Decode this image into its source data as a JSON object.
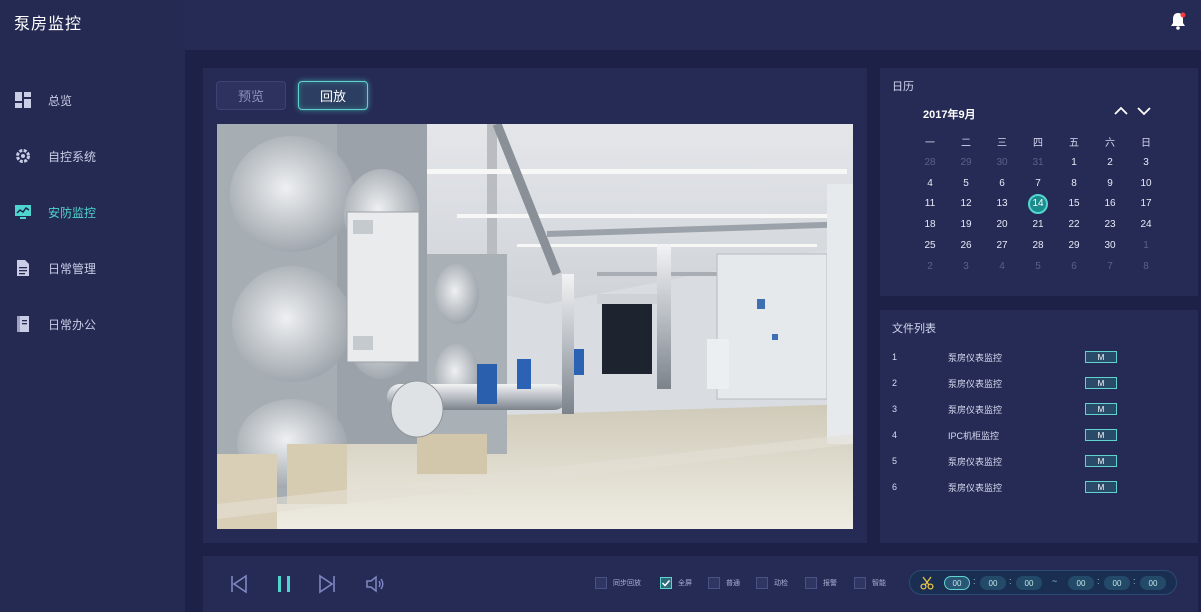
{
  "app": {
    "title": "泵房监控"
  },
  "sidebar": {
    "items": [
      {
        "label": "总览",
        "icon": "dashboard-icon",
        "active": false
      },
      {
        "label": "自控系统",
        "icon": "gear-icon",
        "active": false
      },
      {
        "label": "安防监控",
        "icon": "monitor-chart-icon",
        "active": true
      },
      {
        "label": "日常管理",
        "icon": "document-icon",
        "active": false
      },
      {
        "label": "日常办公",
        "icon": "notebook-icon",
        "active": false
      }
    ]
  },
  "video": {
    "tabs": [
      {
        "label": "预览",
        "active": false
      },
      {
        "label": "回放",
        "active": true
      }
    ]
  },
  "calendar": {
    "title": "日历",
    "month": "2017年9月",
    "weekdays": [
      "一",
      "二",
      "三",
      "四",
      "五",
      "六",
      "日"
    ],
    "selected": "14",
    "weeks": [
      [
        {
          "d": "28",
          "dim": true
        },
        {
          "d": "29",
          "dim": true
        },
        {
          "d": "30",
          "dim": true
        },
        {
          "d": "31",
          "dim": true
        },
        {
          "d": "1"
        },
        {
          "d": "2"
        },
        {
          "d": "3"
        }
      ],
      [
        {
          "d": "4"
        },
        {
          "d": "5"
        },
        {
          "d": "6"
        },
        {
          "d": "7"
        },
        {
          "d": "8"
        },
        {
          "d": "9"
        },
        {
          "d": "10"
        }
      ],
      [
        {
          "d": "11"
        },
        {
          "d": "12"
        },
        {
          "d": "13"
        },
        {
          "d": "14",
          "sel": true
        },
        {
          "d": "15"
        },
        {
          "d": "16"
        },
        {
          "d": "17"
        }
      ],
      [
        {
          "d": "18"
        },
        {
          "d": "19"
        },
        {
          "d": "20"
        },
        {
          "d": "21"
        },
        {
          "d": "22"
        },
        {
          "d": "23"
        },
        {
          "d": "24"
        }
      ],
      [
        {
          "d": "25"
        },
        {
          "d": "26"
        },
        {
          "d": "27"
        },
        {
          "d": "28"
        },
        {
          "d": "29"
        },
        {
          "d": "30"
        },
        {
          "d": "1",
          "dim": true
        }
      ],
      [
        {
          "d": "2",
          "dim": true
        },
        {
          "d": "3",
          "dim": true
        },
        {
          "d": "4",
          "dim": true
        },
        {
          "d": "5",
          "dim": true
        },
        {
          "d": "6",
          "dim": true
        },
        {
          "d": "7",
          "dim": true
        },
        {
          "d": "8",
          "dim": true
        }
      ]
    ]
  },
  "files": {
    "title": "文件列表",
    "button_label": "M",
    "items": [
      {
        "index": "1",
        "name": "泵房仪表监控"
      },
      {
        "index": "2",
        "name": "泵房仪表监控"
      },
      {
        "index": "3",
        "name": "泵房仪表监控"
      },
      {
        "index": "4",
        "name": "IPC机柜监控"
      },
      {
        "index": "5",
        "name": "泵房仪表监控"
      },
      {
        "index": "6",
        "name": "泵房仪表监控"
      }
    ]
  },
  "controls": {
    "options": [
      {
        "label": "同步回放",
        "checked": false
      },
      {
        "label": "全屏",
        "checked": true
      },
      {
        "label": "普通",
        "checked": false
      },
      {
        "label": "动检",
        "checked": false
      },
      {
        "label": "报警",
        "checked": false
      },
      {
        "label": "智能",
        "checked": false
      }
    ],
    "time": {
      "start": [
        "00",
        "00",
        "00"
      ],
      "end": [
        "00",
        "00",
        "00"
      ],
      "separator": ":",
      "range_sep": "~"
    }
  },
  "colors": {
    "accent": "#4fd5d0",
    "background": "#1d2147",
    "panel": "#262b55"
  }
}
